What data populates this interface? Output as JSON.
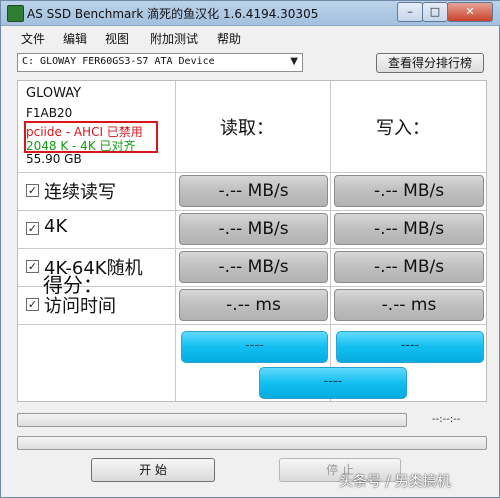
{
  "window": {
    "title": "AS SSD Benchmark 滴死的鱼汉化 1.6.4194.30305",
    "min_glyph": "–",
    "max_glyph": "□",
    "close_glyph": "✕"
  },
  "menu": [
    "文件",
    "编辑",
    "视图",
    "附加测试",
    "帮助"
  ],
  "drive_select": {
    "value": "C: GLOWAY FER60GS3-S7 ATA Device"
  },
  "rank_button": "查看得分排行榜",
  "drive_info": {
    "name": "GLOWAY",
    "firmware": "F1AB20",
    "driver": "pciide - AHCI 已禁用",
    "alignment": "2048 K - 4K 已对齐",
    "size": "55.90 GB"
  },
  "columns": {
    "read": "读取：",
    "write": "写入："
  },
  "rows": [
    {
      "label": "连续读写",
      "checked": true,
      "read": "-.-- MB/s",
      "write": "-.-- MB/s"
    },
    {
      "label": "4K",
      "checked": true,
      "read": "-.-- MB/s",
      "write": "-.-- MB/s"
    },
    {
      "label": "4K-64K随机",
      "checked": true,
      "read": "-.-- MB/s",
      "write": "-.-- MB/s"
    },
    {
      "label": "访问时间",
      "checked": true,
      "read": "-.-- ms",
      "write": "-.-- ms"
    }
  ],
  "score": {
    "label": "得分：",
    "read": "----",
    "write": "----",
    "total": "----"
  },
  "timer": "--:--:--",
  "buttons": {
    "start": "开 始",
    "stop": "停 止"
  },
  "watermark": "头条号 / 另类搞机",
  "colors": {
    "info_red": "#d8161b",
    "info_green": "#149a14",
    "score_blue": "#12bff0"
  }
}
